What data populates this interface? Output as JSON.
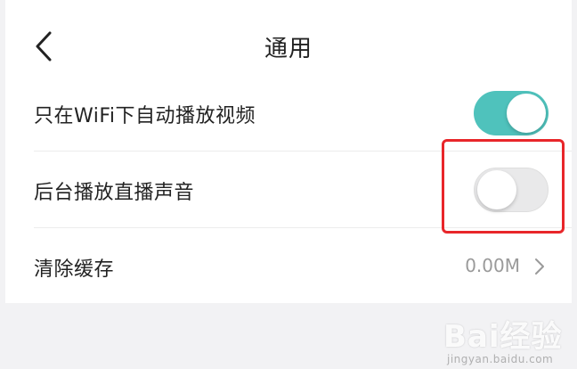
{
  "header": {
    "title": "通用",
    "back_icon": "chevron-left-icon"
  },
  "settings": [
    {
      "label": "只在WiFi下自动播放视频",
      "control": "toggle",
      "state": "on"
    },
    {
      "label": "后台播放直播声音",
      "control": "toggle",
      "state": "off"
    },
    {
      "label": "清除缓存",
      "value": "0.00M",
      "icon": "chevron-right-icon"
    }
  ],
  "colors": {
    "toggle_on": "#4fc2bc",
    "highlight": "#e8262a"
  },
  "watermark": {
    "logo": "Bai经验",
    "sub": "jingyan.baidu.com"
  }
}
